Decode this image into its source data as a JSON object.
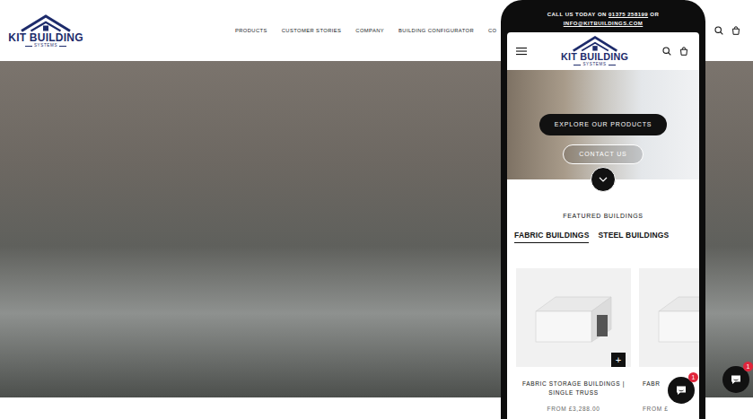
{
  "header": {
    "logo": {
      "main": "KIT BUILDING",
      "sub": "SYSTEMS"
    },
    "nav": [
      "PRODUCTS",
      "CUSTOMER STORIES",
      "COMPANY",
      "BUILDING CONFIGURATOR",
      "CO"
    ]
  },
  "chat": {
    "badge": "1"
  },
  "phone": {
    "topbar": {
      "call": "CALL US TODAY ON",
      "number": "01375 258199",
      "or": "OR",
      "email": "INFO@KITBUILDINGS.COM"
    },
    "logo": {
      "main": "KIT BUILDING",
      "sub": "SYSTEMS"
    },
    "buttons": [
      "EXPLORE OUR PRODUCTS",
      "CONTACT US"
    ],
    "featured": "FEATURED BUILDINGS",
    "tabs": [
      {
        "label": "FABRIC BUILDINGS",
        "selected": true
      },
      {
        "label": "STEEL BUILDINGS",
        "selected": false
      }
    ],
    "products": [
      {
        "title": "FABRIC STORAGE BUILDINGS | SINGLE TRUSS",
        "price": "FROM £3,288.00",
        "add": "+"
      },
      {
        "title": "FABR",
        "price": "FROM £"
      }
    ],
    "chat": {
      "badge": "1"
    }
  }
}
